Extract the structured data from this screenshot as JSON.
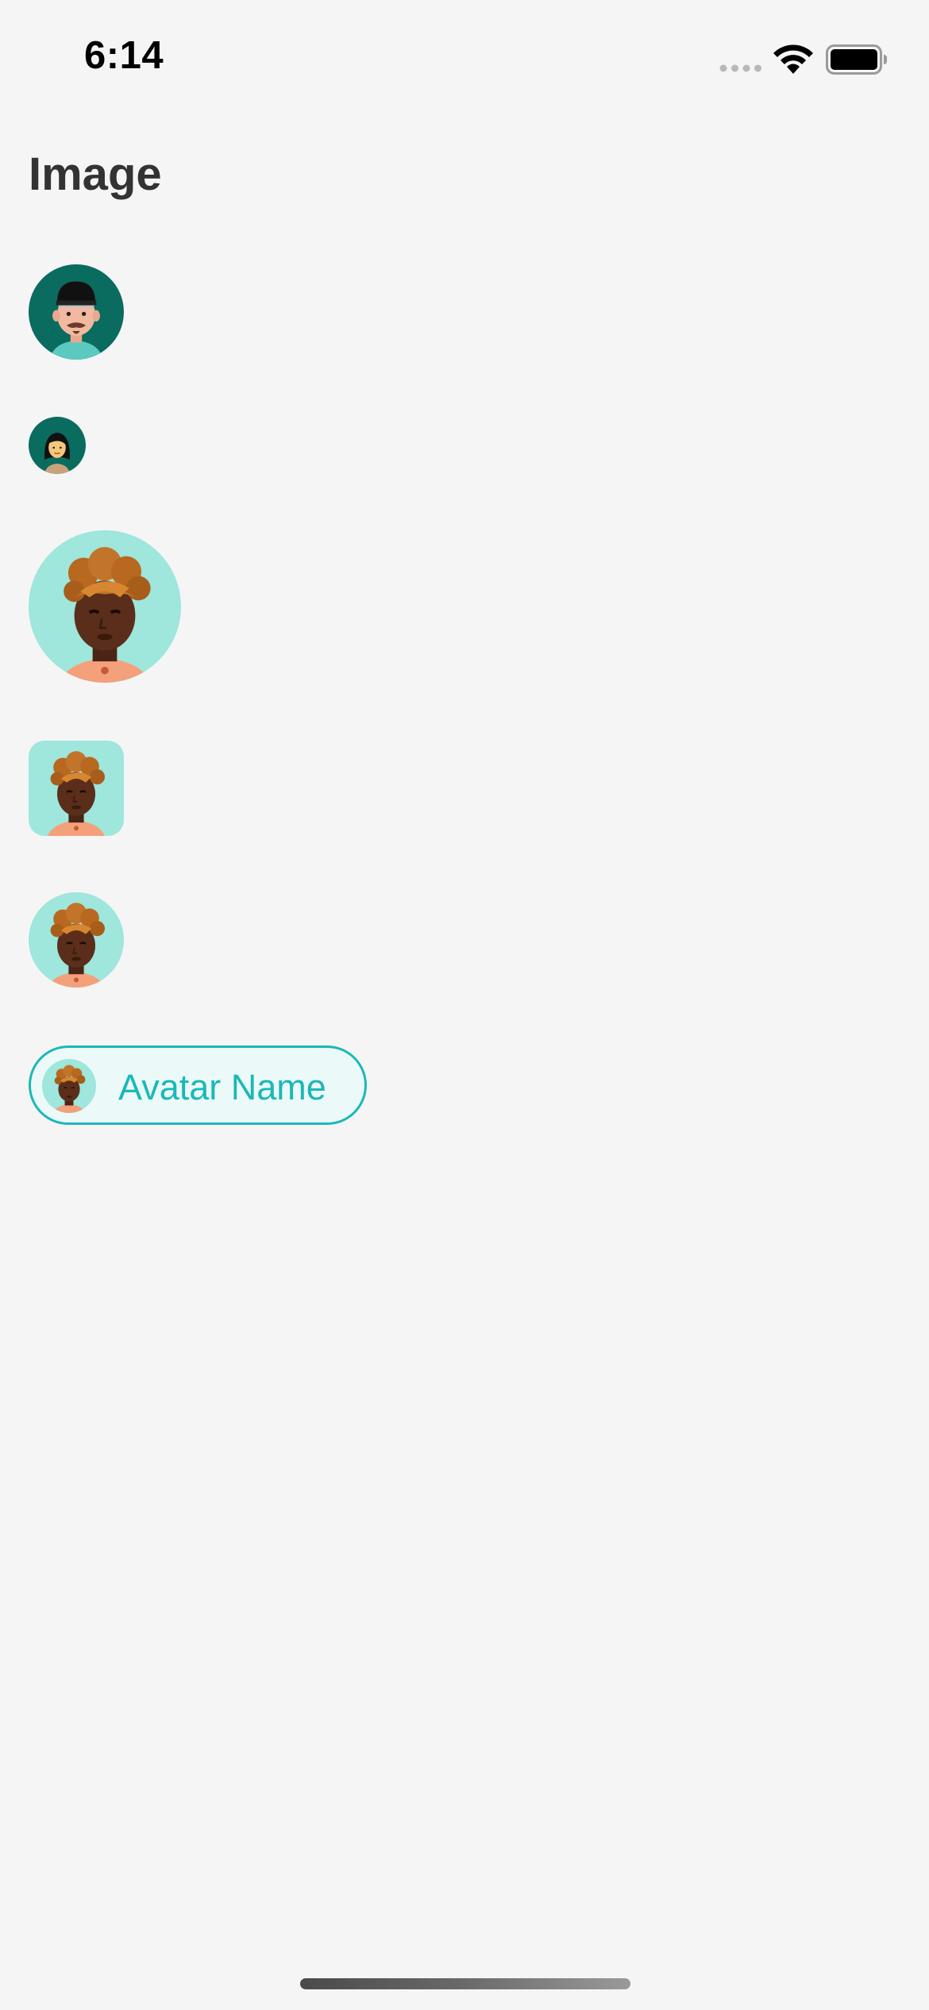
{
  "status_bar": {
    "time": "6:14",
    "icons": [
      "cellular-signal-icon",
      "wifi-icon",
      "battery-icon"
    ]
  },
  "page": {
    "title": "Image"
  },
  "avatars": [
    {
      "name": "avatar-man-cap",
      "shape": "circle",
      "size": "medium"
    },
    {
      "name": "avatar-woman",
      "shape": "circle",
      "size": "small"
    },
    {
      "name": "avatar-woman-headwrap",
      "shape": "circle",
      "size": "large"
    },
    {
      "name": "avatar-woman-headwrap",
      "shape": "rounded-square",
      "size": "medium"
    },
    {
      "name": "avatar-woman-headwrap",
      "shape": "circle",
      "size": "medium"
    }
  ],
  "chip": {
    "label": "Avatar Name"
  },
  "colors": {
    "background": "#f5f5f5",
    "title_text": "#333333",
    "accent_teal": "#1bb8b8",
    "chip_background": "#ecf9f9",
    "avatar_dark_green": "#0a6b5f",
    "avatar_mint": "#9fe6dc",
    "skin_dark": "#5a2e1a",
    "headwrap_orange": "#b8691f"
  }
}
